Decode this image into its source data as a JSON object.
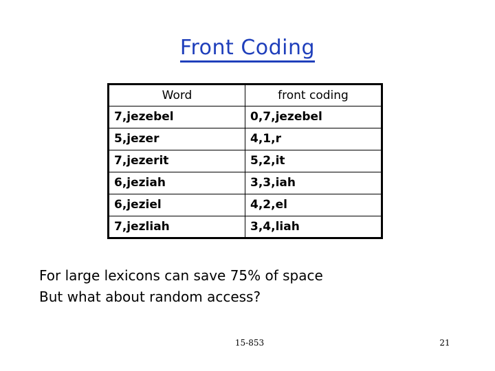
{
  "slide": {
    "title": "Front Coding",
    "title_color": "#1f3fbb",
    "background_color": "#ffffff"
  },
  "table": {
    "headers": [
      "Word",
      "front coding"
    ],
    "rows": [
      {
        "word": "7,jezebel",
        "front_coding": "0,7,jezebel"
      },
      {
        "word": "5,jezer",
        "front_coding": "4,1,r"
      },
      {
        "word": "7,jezerit",
        "front_coding": "5,2,it"
      },
      {
        "word": "6,jeziah",
        "front_coding": "3,3,iah"
      },
      {
        "word": "6,jeziel",
        "front_coding": "4,2,el"
      },
      {
        "word": "7,jezliah",
        "front_coding": "3,4,liah"
      }
    ]
  },
  "body": {
    "lines": [
      "For large lexicons can save 75% of space",
      "But what about random access?"
    ]
  },
  "footer": {
    "course": "15-853",
    "page_number": "21"
  }
}
